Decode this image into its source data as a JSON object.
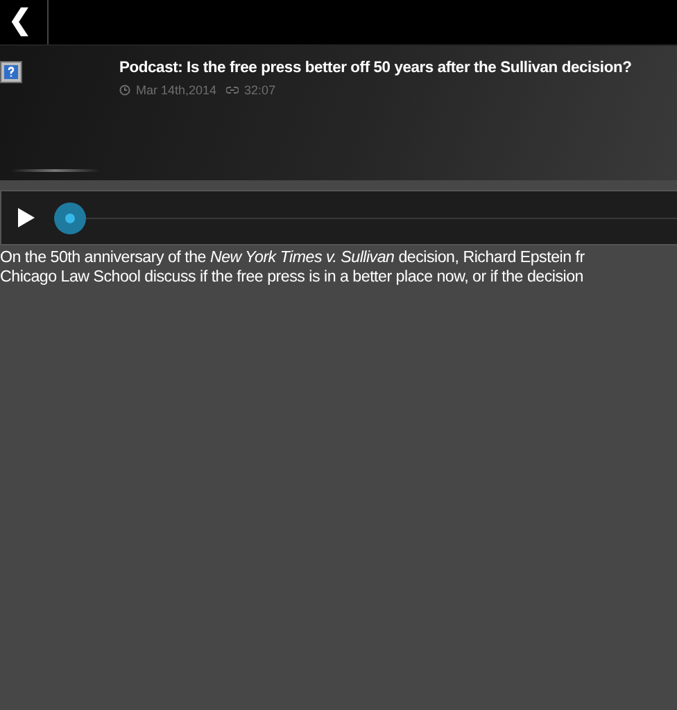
{
  "header": {
    "back_label": "❮"
  },
  "episode": {
    "title": "Podcast: Is the free press better off 50 years after the Sullivan decision?",
    "date": "Mar 14th,2014",
    "duration": "32:07"
  },
  "player": {
    "playing": false
  },
  "description": [
    "On the 50th anniversary of the *New York Times v. Sullivan* decision, Richard Epstein fr",
    "Chicago Law School discuss if the free press is in a better place now, or if the decision"
  ]
}
